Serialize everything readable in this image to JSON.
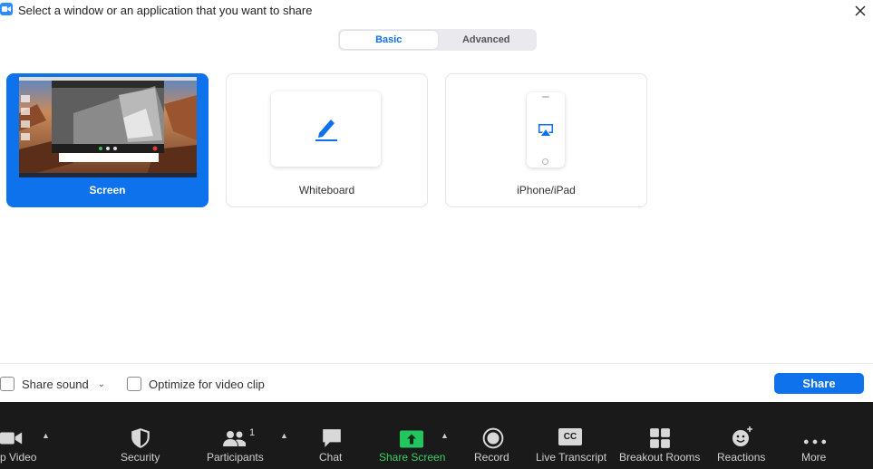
{
  "window": {
    "title": "Select a window or an application that you want to share"
  },
  "tabs": [
    {
      "label": "Basic",
      "active": true
    },
    {
      "label": "Advanced",
      "active": false
    }
  ],
  "cards": [
    {
      "label": "Screen",
      "selected": true,
      "icon": "screen-thumbnail"
    },
    {
      "label": "Whiteboard",
      "selected": false,
      "icon": "pencil-icon"
    },
    {
      "label": "iPhone/iPad",
      "selected": false,
      "icon": "airplay-icon"
    }
  ],
  "options": {
    "share_sound": "Share sound",
    "share_sound_checked": false,
    "optimize_video": "Optimize for video clip",
    "optimize_video_checked": false,
    "share_button": "Share"
  },
  "toolbar": {
    "items": [
      {
        "label": "p Video",
        "icon": "video-camera-icon"
      },
      {
        "label": "Security",
        "icon": "shield-icon"
      },
      {
        "label": "Participants",
        "icon": "participants-icon",
        "badge": "1"
      },
      {
        "label": "Chat",
        "icon": "chat-icon"
      },
      {
        "label": "Share Screen",
        "icon": "share-screen-icon"
      },
      {
        "label": "Record",
        "icon": "record-icon"
      },
      {
        "label": "Live Transcript",
        "icon": "cc-icon",
        "icon_text": "CC"
      },
      {
        "label": "Breakout Rooms",
        "icon": "breakout-rooms-icon"
      },
      {
        "label": "Reactions",
        "icon": "reactions-icon"
      },
      {
        "label": "More",
        "icon": "more-icon"
      }
    ]
  },
  "colors": {
    "accent": "#0e72ed",
    "share_green": "#22c55e",
    "toolbar_bg": "#1a1a1a"
  }
}
